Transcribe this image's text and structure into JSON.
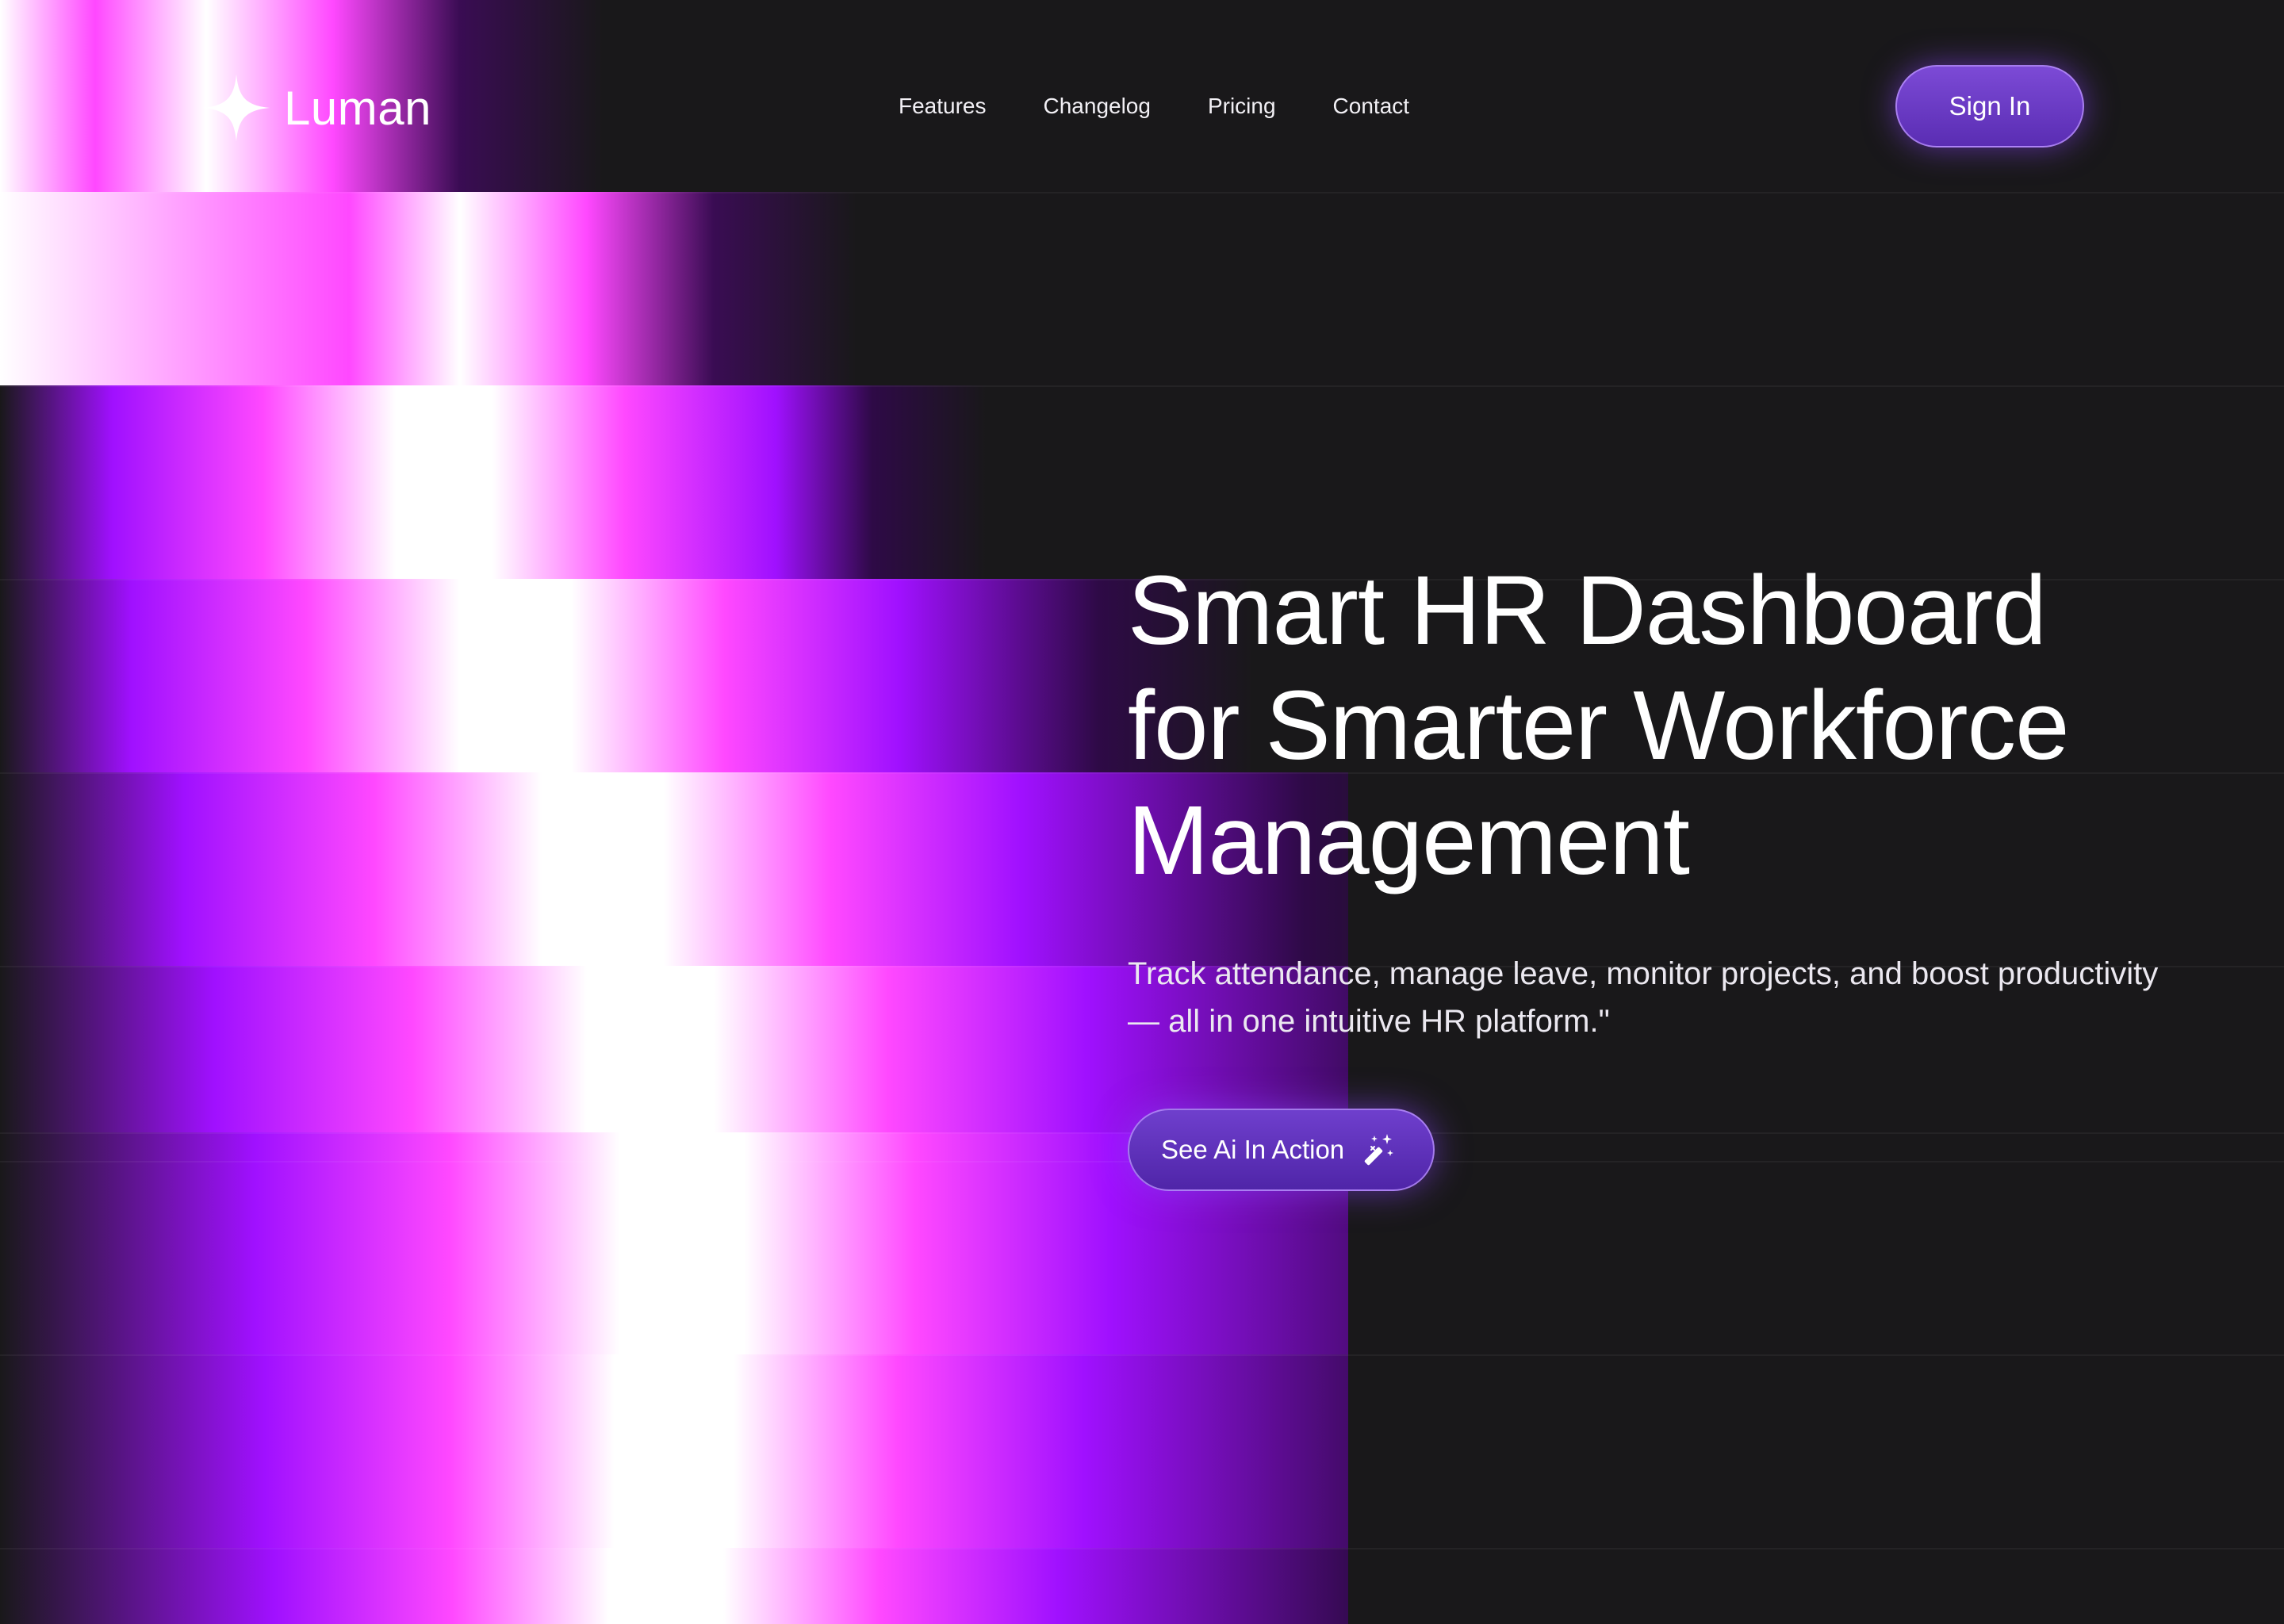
{
  "brand": {
    "name": "Luman",
    "logo_icon": "sparkle-star-icon"
  },
  "nav": {
    "links": [
      {
        "label": "Features"
      },
      {
        "label": "Changelog"
      },
      {
        "label": "Pricing"
      },
      {
        "label": "Contact"
      }
    ],
    "signin_label": "Sign In"
  },
  "hero": {
    "title_lines": [
      "Smart HR Dashboard",
      "for Smarter Workforce",
      "Management"
    ],
    "subtitle": "Track attendance, manage leave, monitor projects, and boost productivity — all in one intuitive HR platform.\"",
    "cta_label": "See Ai In Action",
    "cta_icon": "magic-wand-icon"
  },
  "colors": {
    "background": "#19181a",
    "accent": "#7c4ad6",
    "glow_violet": "#a010ff",
    "glow_magenta": "#ff48ff",
    "text": "#ffffff"
  }
}
